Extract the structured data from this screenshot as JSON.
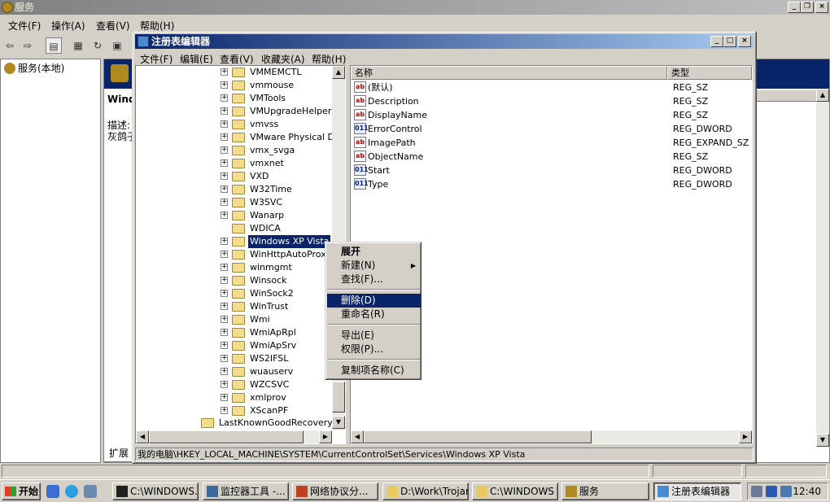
{
  "services": {
    "title": "服务",
    "menu": [
      "文件(F)",
      "操作(A)",
      "查看(V)",
      "帮助(H)"
    ],
    "tree_root": "服务(本地)",
    "service_name": "Windo",
    "desc_label": "描述:",
    "desc_text": "灰鸽子",
    "tab_label": "扩展"
  },
  "regedit": {
    "title": "注册表编辑器",
    "menu": [
      "文件(F)",
      "编辑(E)",
      "查看(V)",
      "收藏夹(A)",
      "帮助(H)"
    ],
    "tree_items": [
      {
        "label": "VMMEMCTL",
        "expandable": true
      },
      {
        "label": "vmmouse",
        "expandable": true
      },
      {
        "label": "VMTools",
        "expandable": true
      },
      {
        "label": "VMUpgradeHelper",
        "expandable": true
      },
      {
        "label": "vmvss",
        "expandable": true
      },
      {
        "label": "VMware Physical Disk",
        "expandable": true
      },
      {
        "label": "vmx_svga",
        "expandable": true
      },
      {
        "label": "vmxnet",
        "expandable": true
      },
      {
        "label": "VXD",
        "expandable": true
      },
      {
        "label": "W32Time",
        "expandable": true
      },
      {
        "label": "W3SVC",
        "expandable": true
      },
      {
        "label": "Wanarp",
        "expandable": true
      },
      {
        "label": "WDICA",
        "expandable": false
      },
      {
        "label": "Windows XP Vista",
        "expandable": true,
        "selected": true
      },
      {
        "label": "WinHttpAutoProxySvc",
        "expandable": true
      },
      {
        "label": "winmgmt",
        "expandable": true
      },
      {
        "label": "Winsock",
        "expandable": true
      },
      {
        "label": "WinSock2",
        "expandable": true
      },
      {
        "label": "WinTrust",
        "expandable": true
      },
      {
        "label": "Wmi",
        "expandable": true
      },
      {
        "label": "WmiApRpl",
        "expandable": true
      },
      {
        "label": "WmiApSrv",
        "expandable": true
      },
      {
        "label": "WS2IFSL",
        "expandable": true
      },
      {
        "label": "wuauserv",
        "expandable": true
      },
      {
        "label": "WZCSVC",
        "expandable": true
      },
      {
        "label": "xmlprov",
        "expandable": true
      },
      {
        "label": "XScanPF",
        "expandable": true
      }
    ],
    "tree_parent_item": "LastKnownGoodRecovery",
    "columns": {
      "name": "名称",
      "type": "类型"
    },
    "values": [
      {
        "name": "(默认)",
        "type": "REG_SZ",
        "kind": "string"
      },
      {
        "name": "Description",
        "type": "REG_SZ",
        "kind": "string"
      },
      {
        "name": "DisplayName",
        "type": "REG_SZ",
        "kind": "string"
      },
      {
        "name": "ErrorControl",
        "type": "REG_DWORD",
        "kind": "binary"
      },
      {
        "name": "ImagePath",
        "type": "REG_EXPAND_SZ",
        "kind": "string"
      },
      {
        "name": "ObjectName",
        "type": "REG_SZ",
        "kind": "string"
      },
      {
        "name": "Start",
        "type": "REG_DWORD",
        "kind": "binary"
      },
      {
        "name": "Type",
        "type": "REG_DWORD",
        "kind": "binary"
      }
    ],
    "status_path": "我的电脑\\HKEY_LOCAL_MACHINE\\SYSTEM\\CurrentControlSet\\Services\\Windows XP Vista"
  },
  "context_menu": {
    "items": [
      {
        "label": "展开",
        "bold": true
      },
      {
        "label": "新建(N)",
        "submenu": true
      },
      {
        "label": "查找(F)..."
      },
      {
        "separator": true
      },
      {
        "label": "删除(D)",
        "highlighted": true
      },
      {
        "label": "重命名(R)"
      },
      {
        "separator": true
      },
      {
        "label": "导出(E)"
      },
      {
        "label": "权限(P)..."
      },
      {
        "separator": true
      },
      {
        "label": "复制项名称(C)"
      }
    ]
  },
  "taskbar": {
    "start_label": "开始",
    "tasks": [
      {
        "label": "C:\\WINDOWS...",
        "icon": "cmd-icon"
      },
      {
        "label": "监控器工具 -...",
        "icon": "monitor-icon"
      },
      {
        "label": "网络协议分...",
        "icon": "network-icon"
      },
      {
        "label": "D:\\Work\\Trojan",
        "icon": "folder-icon"
      },
      {
        "label": "C:\\WINDOWS",
        "icon": "folder-icon"
      },
      {
        "label": "服务",
        "icon": "services-icon"
      },
      {
        "label": "注册表编辑器",
        "icon": "regedit-icon",
        "active": true
      }
    ],
    "clock": "12:40"
  },
  "colors": {
    "selection": "#0a246a",
    "face": "#d4d0c8",
    "title_active_start": "#0a246a",
    "title_active_end": "#a6caf0"
  }
}
